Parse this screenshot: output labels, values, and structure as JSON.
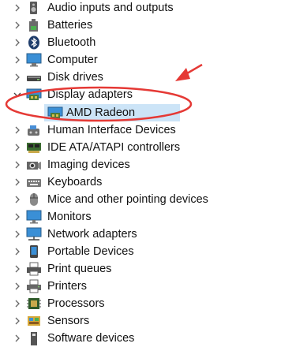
{
  "tree": {
    "items": [
      {
        "label": "Audio inputs and outputs",
        "icon": "speaker-icon",
        "state": "collapsed"
      },
      {
        "label": "Batteries",
        "icon": "battery-icon",
        "state": "collapsed"
      },
      {
        "label": "Bluetooth",
        "icon": "bluetooth-icon",
        "state": "collapsed"
      },
      {
        "label": "Computer",
        "icon": "computer-icon",
        "state": "collapsed"
      },
      {
        "label": "Disk drives",
        "icon": "disk-drive-icon",
        "state": "collapsed"
      },
      {
        "label": "Display adapters",
        "icon": "display-adapter-icon",
        "state": "expanded",
        "children": [
          {
            "label": "AMD Radeon",
            "icon": "display-adapter-icon",
            "selected": true
          }
        ]
      },
      {
        "label": "Human Interface Devices",
        "icon": "hid-icon",
        "state": "collapsed"
      },
      {
        "label": "IDE ATA/ATAPI controllers",
        "icon": "ide-controller-icon",
        "state": "collapsed"
      },
      {
        "label": "Imaging devices",
        "icon": "camera-icon",
        "state": "collapsed"
      },
      {
        "label": "Keyboards",
        "icon": "keyboard-icon",
        "state": "collapsed"
      },
      {
        "label": "Mice and other pointing devices",
        "icon": "mouse-icon",
        "state": "collapsed"
      },
      {
        "label": "Monitors",
        "icon": "monitor-icon",
        "state": "collapsed"
      },
      {
        "label": "Network adapters",
        "icon": "network-icon",
        "state": "collapsed"
      },
      {
        "label": "Portable Devices",
        "icon": "portable-device-icon",
        "state": "collapsed"
      },
      {
        "label": "Print queues",
        "icon": "print-queue-icon",
        "state": "collapsed"
      },
      {
        "label": "Printers",
        "icon": "printer-icon",
        "state": "collapsed"
      },
      {
        "label": "Processors",
        "icon": "processor-icon",
        "state": "collapsed"
      },
      {
        "label": "Sensors",
        "icon": "sensor-icon",
        "state": "collapsed"
      },
      {
        "label": "Software devices",
        "icon": "software-device-icon",
        "state": "collapsed"
      }
    ]
  },
  "annotation": {
    "color": "#e53935",
    "shapes": [
      "ellipse",
      "arrow"
    ]
  },
  "colors": {
    "selection": "#cce4f7",
    "chevron": "#666666"
  }
}
